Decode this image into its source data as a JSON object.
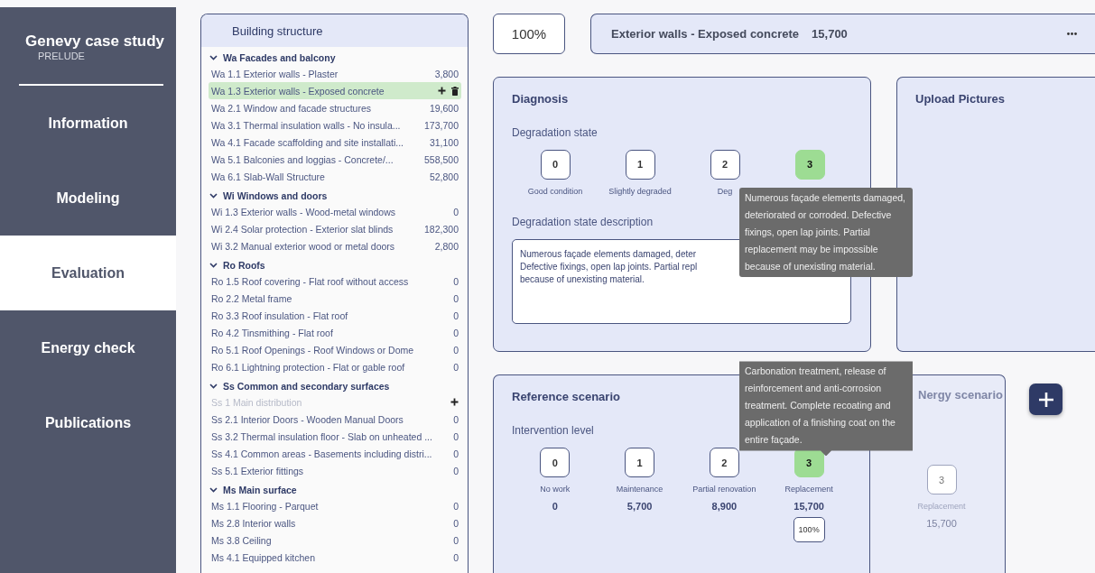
{
  "sidebar": {
    "title": "Genevy case study",
    "subtitle": "PRELUDE",
    "items": [
      {
        "label": "Information",
        "selected": false
      },
      {
        "label": "Modeling",
        "selected": false
      },
      {
        "label": "Evaluation",
        "selected": true
      },
      {
        "label": "Energy check",
        "selected": false
      },
      {
        "label": "Publications",
        "selected": false
      }
    ]
  },
  "tree": {
    "title": "Building structure",
    "groups": [
      {
        "label": "Wa Facades and balcony",
        "expanded": true,
        "children": [
          {
            "label": "Wa 1.1 Exterior walls - Plaster",
            "value": "3,800",
            "selected": false,
            "disabled": false
          },
          {
            "label": "Wa 1.3 Exterior walls - Exposed concrete",
            "selected": true,
            "disabled": false
          },
          {
            "label": "Wa 2.1 Window and facade structures",
            "value": "19,600",
            "selected": false,
            "disabled": false
          },
          {
            "label": "Wa 3.1 Thermal insulation walls - No insula...",
            "value": "173,700",
            "selected": false,
            "disabled": false
          },
          {
            "label": "Wa 4.1 Facade scaffolding and site installati...",
            "value": "31,100",
            "selected": false,
            "disabled": false
          },
          {
            "label": "Wa 5.1 Balconies and loggias - Concrete/...",
            "value": "558,500",
            "selected": false,
            "disabled": false
          },
          {
            "label": "Wa 6.1 Slab-Wall Structure",
            "value": "52,800",
            "selected": false,
            "disabled": false
          }
        ]
      },
      {
        "label": "Wi Windows and doors",
        "expanded": true,
        "children": [
          {
            "label": "Wi 1.3 Exterior walls - Wood-metal windows",
            "value": "0",
            "selected": false,
            "disabled": false
          },
          {
            "label": "Wi 2.4 Solar protection - Exterior slat blinds",
            "value": "182,300",
            "selected": false,
            "disabled": false
          },
          {
            "label": "Wi 3.2 Manual exterior wood or metal doors",
            "value": "2,800",
            "selected": false,
            "disabled": false
          }
        ]
      },
      {
        "label": "Ro Roofs",
        "expanded": true,
        "children": [
          {
            "label": "Ro 1.5 Roof covering - Flat roof without access",
            "value": "0",
            "selected": false,
            "disabled": false
          },
          {
            "label": "Ro 2.2 Metal frame",
            "value": "0",
            "selected": false,
            "disabled": false
          },
          {
            "label": "Ro 3.3 Roof insulation - Flat roof",
            "value": "0",
            "selected": false,
            "disabled": false
          },
          {
            "label": "Ro 4.2 Tinsmithing - Flat roof",
            "value": "0",
            "selected": false,
            "disabled": false
          },
          {
            "label": "Ro 5.1 Roof Openings - Roof Windows or Dome",
            "value": "0",
            "selected": false,
            "disabled": false
          },
          {
            "label": "Ro 6.1 Lightning protection - Flat or gable roof",
            "value": "0",
            "selected": false,
            "disabled": false
          }
        ]
      },
      {
        "label": "Ss Common and secondary surfaces",
        "expanded": true,
        "children": [
          {
            "label": "Ss 1 Main distribution",
            "selected": false,
            "disabled": true
          },
          {
            "label": "Ss 2.1 Interior Doors - Wooden Manual Doors",
            "value": "0",
            "selected": false,
            "disabled": false
          },
          {
            "label": "Ss 3.2 Thermal insulation floor - Slab on unheated ...",
            "value": "0",
            "selected": false,
            "disabled": false
          },
          {
            "label": "Ss 4.1 Common areas - Basements including distri...",
            "value": "0",
            "selected": false,
            "disabled": false
          },
          {
            "label": "Ss 5.1 Exterior fittings",
            "value": "0",
            "selected": false,
            "disabled": false
          }
        ]
      },
      {
        "label": "Ms Main surface",
        "expanded": true,
        "children": [
          {
            "label": "Ms 1.1 Flooring - Parquet",
            "value": "0",
            "selected": false,
            "disabled": false
          },
          {
            "label": "Ms 2.8 Interior walls",
            "value": "0",
            "selected": false,
            "disabled": false
          },
          {
            "label": "Ms 3.8 Ceiling",
            "value": "0",
            "selected": false,
            "disabled": false
          },
          {
            "label": "Ms 4.1 Equipped kitchen",
            "value": "0",
            "selected": false,
            "disabled": false
          }
        ]
      }
    ]
  },
  "percent_field": {
    "value": "100%"
  },
  "element_header": {
    "title": "Exterior walls - Exposed concrete",
    "amount": "15,700"
  },
  "diagnosis": {
    "title": "Diagnosis",
    "state_label": "Degradation state",
    "options": [
      {
        "number": "0",
        "label": "Good condition",
        "selected": false
      },
      {
        "number": "1",
        "label": "Slightly degraded",
        "selected": false
      },
      {
        "number": "2",
        "label": "Deg",
        "selected": false
      },
      {
        "number": "3",
        "selected": true
      }
    ],
    "description_label": "Degradation state description",
    "description": "Numerous façade elements damaged, deter\nDefective fixings, open lap joints. Partial repl\nbecause of unexisting material.",
    "tooltip": "Numerous façade elements damaged, deteriorated or corroded. Defective fixings, open lap joints. Partial replacement may be impossible because of unexisting material."
  },
  "upload": {
    "title": "Upload Pictures"
  },
  "reference_scenario": {
    "title": "Reference scenario",
    "level_label": "Intervention level",
    "options": [
      {
        "number": "0",
        "label": "No work",
        "cost": "0",
        "selected": false
      },
      {
        "number": "1",
        "label": "Maintenance",
        "cost": "5,700",
        "selected": false
      },
      {
        "number": "2",
        "label": "Partial renovation",
        "cost": "8,900",
        "selected": false
      },
      {
        "number": "3",
        "label": "Replacement",
        "cost": "15,700",
        "selected": true,
        "share": "100%"
      }
    ],
    "tooltip": "Carbonation treatment, release of reinforcement and anti-corrosion treatment. Complete recoating and application of a finishing coat on the entire façade."
  },
  "energy_scenario": {
    "title": "Nergy scenario",
    "number": "3",
    "label": "Replacement",
    "cost": "15,700"
  }
}
